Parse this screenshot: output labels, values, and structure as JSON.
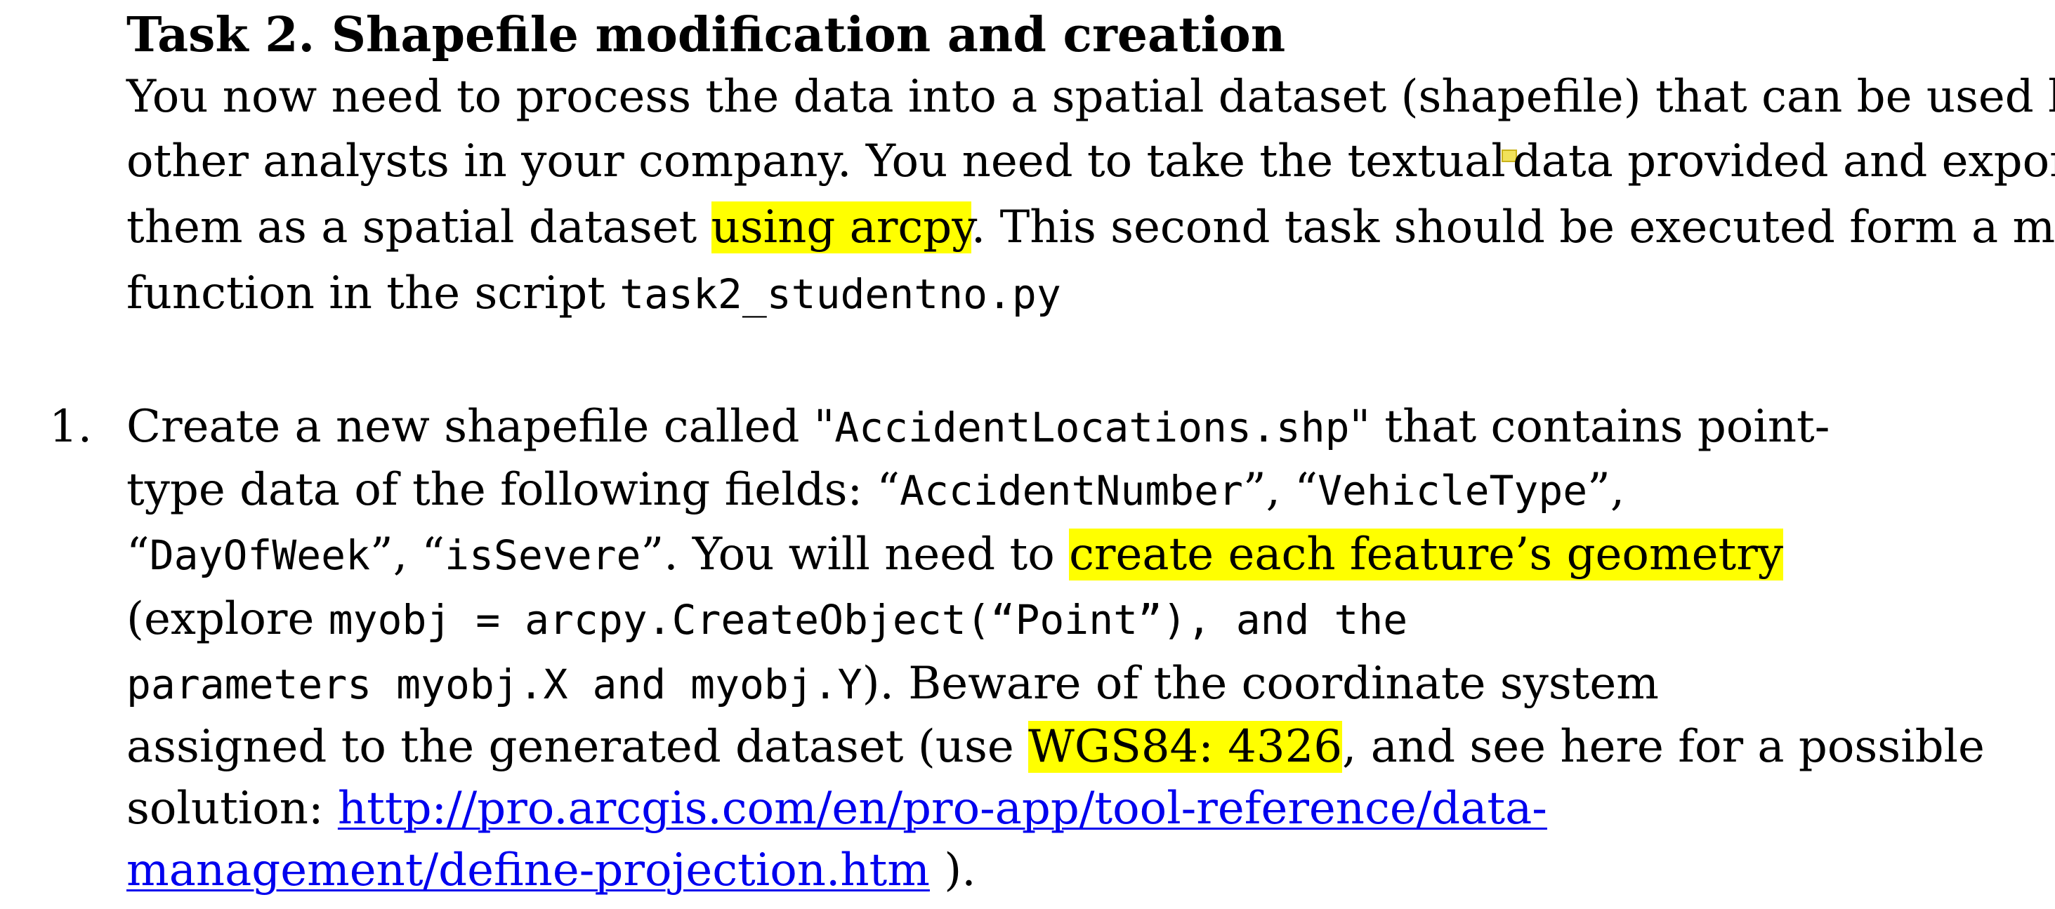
{
  "task": {
    "heading": "Task 2. Shapefile modification and creation",
    "intro": {
      "l1": "You now need to process the data into a spatial dataset (shapefile) that can be used by",
      "l2a": "other analysts in your company. You need to take the textual",
      "l2b": "data provided and export",
      "l3a": "them as a spatial dataset ",
      "l3_highlight": "using arcpy",
      "l3b": ". This second task should be executed form a main",
      "l4a": "function in the script ",
      "l4_code": "task2_studentno.py"
    }
  },
  "item1": {
    "number": "1.",
    "l1a": "Create a new shapefile called \"",
    "l1_code": "AccidentLocations.shp",
    "l1b": "\" that contains point-",
    "l2a": "type data of the following fields: “",
    "l2_code1": "AccidentNumber",
    "l2b": "”, “",
    "l2_code2": "VehicleType",
    "l2c": "”,",
    "l3a": "“",
    "l3_code1": "DayOfWeek",
    "l3b": "”, “",
    "l3_code2": "isSevere",
    "l3c": "”. You will need to ",
    "l3_highlight": "create each feature’s geometry",
    "l4a": "(explore ",
    "l4_code": "myobj = arcpy.CreateObject(“Point”), and the",
    "l5_code": "parameters myobj.X and myobj.Y",
    "l5b": "). Beware of the coordinate system",
    "l6a": "assigned to the generated dataset (use ",
    "l6_highlight": "WGS84: 4326",
    "l6b": ", and see here for a possible",
    "l7a": "solution: ",
    "link_part1": "http://pro.arcgis.com/en/pro-app/tool-reference/data-",
    "link_part2": "management/define-projection.htm",
    "l8b": " )."
  }
}
